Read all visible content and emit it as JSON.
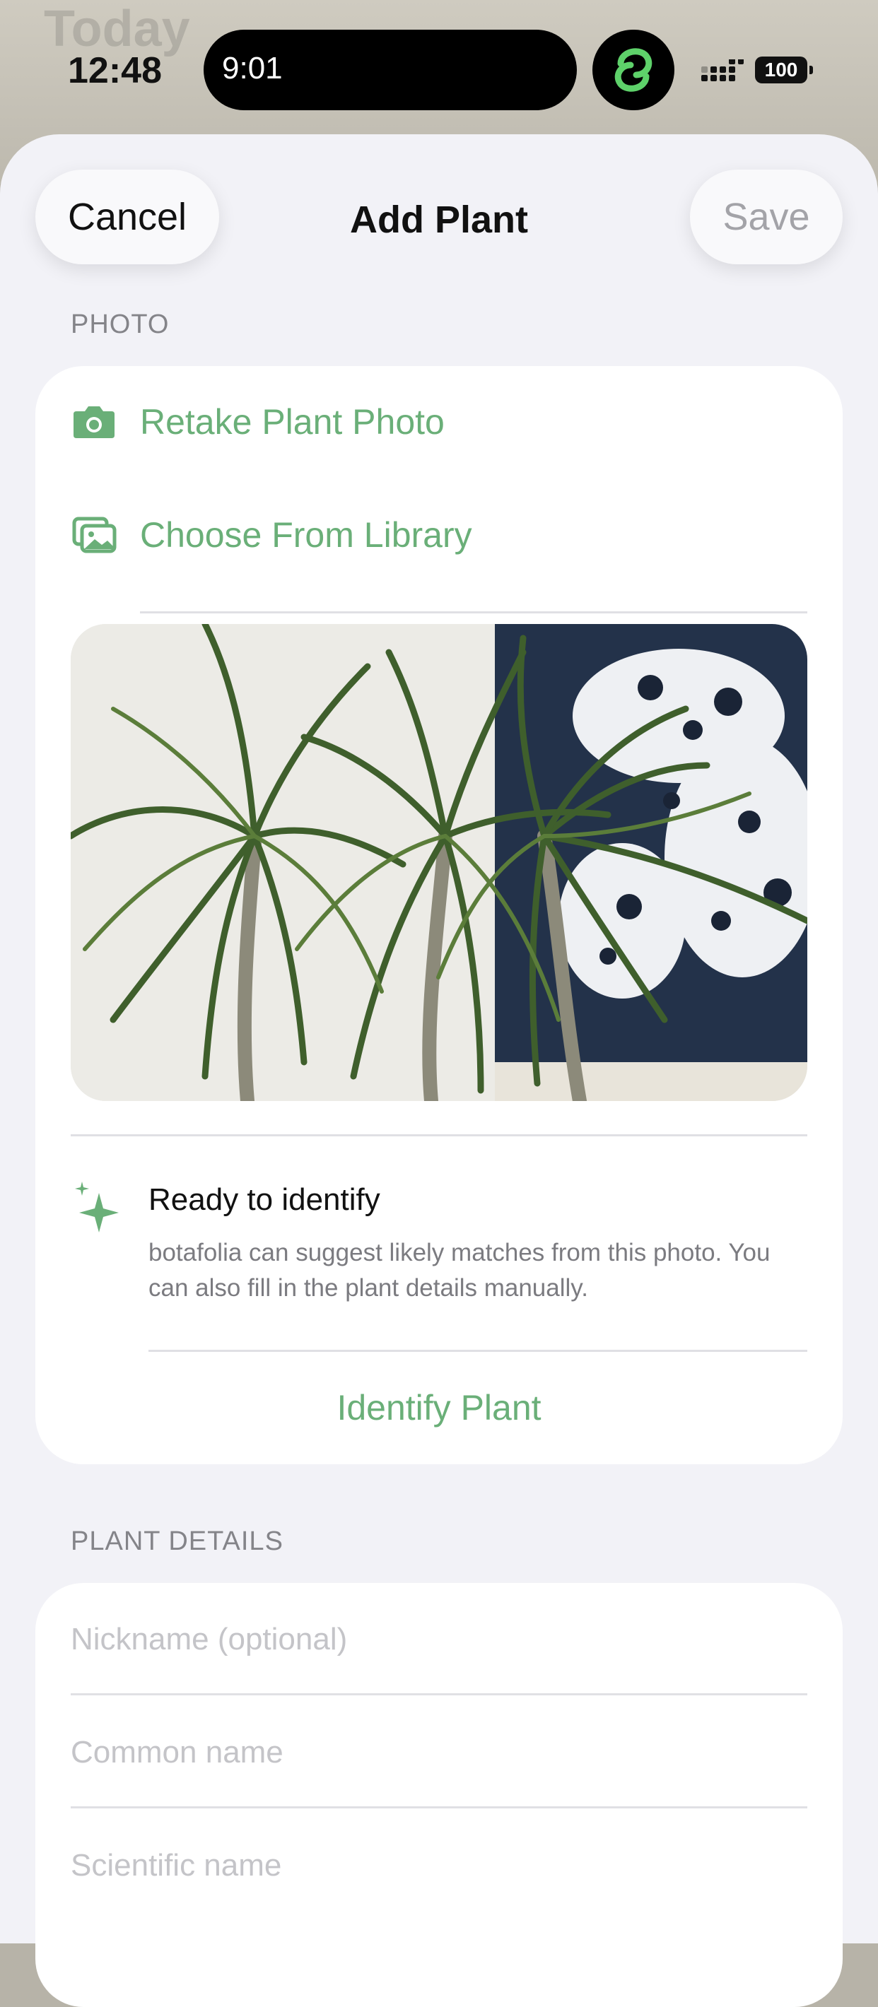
{
  "backdrop": {
    "title": "Today"
  },
  "status_bar": {
    "time": "12:48",
    "island_time": "9:01",
    "battery": "100"
  },
  "nav": {
    "cancel_label": "Cancel",
    "title": "Add Plant",
    "save_label": "Save"
  },
  "photo_section": {
    "header": "PHOTO",
    "actions": [
      {
        "label": "Retake Plant Photo",
        "icon": "camera-icon"
      },
      {
        "label": "Choose From Library",
        "icon": "photo-library-icon"
      }
    ],
    "identify": {
      "icon": "sparkles-icon",
      "title": "Ready to identify",
      "description": "botafolia can suggest likely matches from this photo. You can also fill in the plant details manually.",
      "button_label": "Identify Plant"
    }
  },
  "details_section": {
    "header": "PLANT DETAILS",
    "fields": [
      {
        "placeholder": "Nickname (optional)"
      },
      {
        "placeholder": "Common name"
      },
      {
        "placeholder": "Scientific name"
      }
    ]
  },
  "colors": {
    "accent": "#6aaf78",
    "sheet_bg": "#f2f2f7",
    "card_bg": "#ffffff",
    "placeholder": "#c4c4c8"
  }
}
